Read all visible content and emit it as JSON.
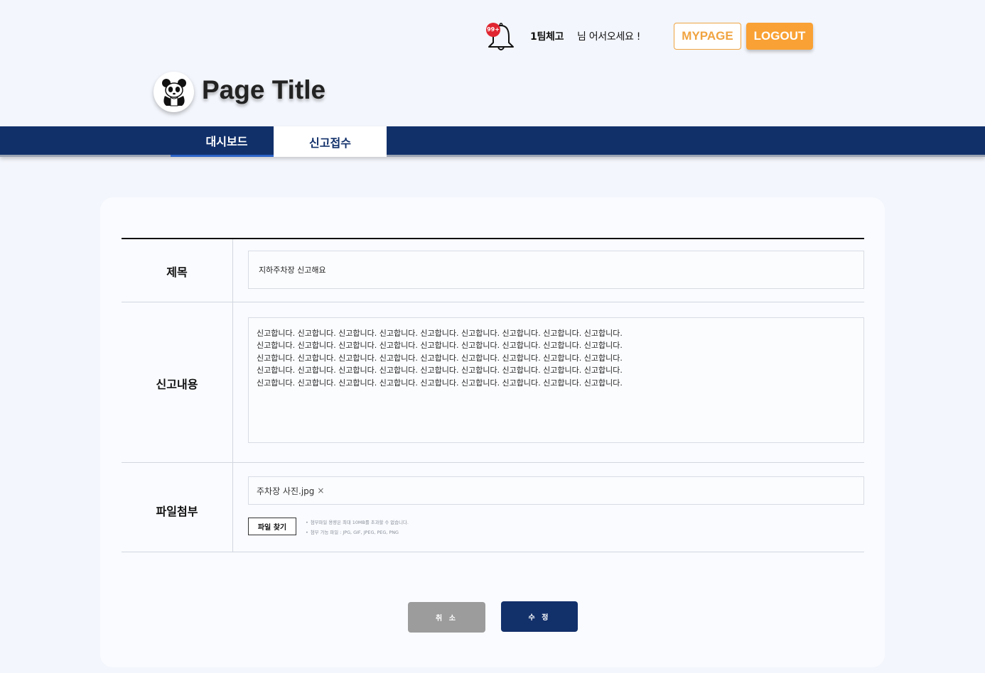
{
  "header": {
    "notification_badge": "99+",
    "user_name": "1팀체고",
    "greeting": "님 어서오세요 !",
    "mypage_label": "MYPAGE",
    "logout_label": "LOGOUT",
    "page_title": "Page Title",
    "logo_icon": "panda-logo-icon"
  },
  "nav": {
    "tabs": [
      {
        "label": "대시보드",
        "active": false
      },
      {
        "label": "신고접수",
        "active": true
      }
    ]
  },
  "form": {
    "title_label": "제목",
    "title_value": "지하주차장 신고해요",
    "content_label": "신고내용",
    "content_value": "신고합니다. 신고합니다. 신고합니다. 신고합니다. 신고합니다. 신고합니다. 신고합니다. 신고합니다. 신고합니다.\n신고합니다. 신고합니다. 신고합니다. 신고합니다. 신고합니다. 신고합니다. 신고합니다. 신고합니다. 신고합니다.\n신고합니다. 신고합니다. 신고합니다. 신고합니다. 신고합니다. 신고합니다. 신고합니다. 신고합니다. 신고합니다.\n신고합니다. 신고합니다. 신고합니다. 신고합니다. 신고합니다. 신고합니다. 신고합니다. 신고합니다. 신고합니다.\n신고합니다. 신고합니다. 신고합니다. 신고합니다. 신고합니다. 신고합니다. 신고합니다. 신고합니다. 신고합니다.",
    "file_label": "파일첨부",
    "attached_file": "주차장 사진.jpg",
    "remove_icon_glyph": "×",
    "browse_label": "파일 찾기",
    "notes": [
      "첨부파일 용량은 최대 10MB를 초과할 수 없습니다.",
      "첨부 가능 파일 : JPG, GIF, JPEG, PEG, PNG"
    ]
  },
  "actions": {
    "cancel_label": "취 소",
    "submit_label": "수 정"
  },
  "colors": {
    "navy": "#11306a",
    "orange": "#f9a134",
    "badge_red": "#e02631"
  }
}
